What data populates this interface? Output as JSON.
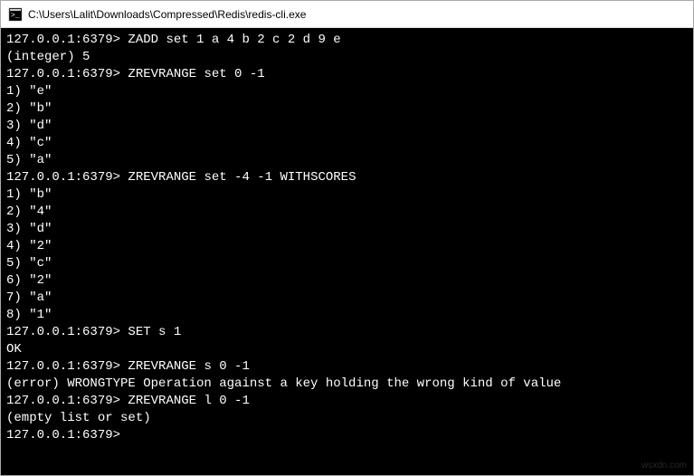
{
  "window": {
    "title": "C:\\Users\\Lalit\\Downloads\\Compressed\\Redis\\redis-cli.exe"
  },
  "terminal": {
    "lines": [
      {
        "prompt": "127.0.0.1:6379>",
        "text": " ZADD set 1 a 4 b 2 c 2 d 9 e"
      },
      {
        "prompt": "",
        "text": "(integer) 5"
      },
      {
        "prompt": "127.0.0.1:6379>",
        "text": " ZREVRANGE set 0 -1"
      },
      {
        "prompt": "",
        "text": "1) \"e\""
      },
      {
        "prompt": "",
        "text": "2) \"b\""
      },
      {
        "prompt": "",
        "text": "3) \"d\""
      },
      {
        "prompt": "",
        "text": "4) \"c\""
      },
      {
        "prompt": "",
        "text": "5) \"a\""
      },
      {
        "prompt": "127.0.0.1:6379>",
        "text": " ZREVRANGE set -4 -1 WITHSCORES"
      },
      {
        "prompt": "",
        "text": "1) \"b\""
      },
      {
        "prompt": "",
        "text": "2) \"4\""
      },
      {
        "prompt": "",
        "text": "3) \"d\""
      },
      {
        "prompt": "",
        "text": "4) \"2\""
      },
      {
        "prompt": "",
        "text": "5) \"c\""
      },
      {
        "prompt": "",
        "text": "6) \"2\""
      },
      {
        "prompt": "",
        "text": "7) \"a\""
      },
      {
        "prompt": "",
        "text": "8) \"1\""
      },
      {
        "prompt": "127.0.0.1:6379>",
        "text": " SET s 1"
      },
      {
        "prompt": "",
        "text": "OK"
      },
      {
        "prompt": "127.0.0.1:6379>",
        "text": " ZREVRANGE s 0 -1"
      },
      {
        "prompt": "",
        "text": "(error) WRONGTYPE Operation against a key holding the wrong kind of value"
      },
      {
        "prompt": "127.0.0.1:6379>",
        "text": " ZREVRANGE l 0 -1"
      },
      {
        "prompt": "",
        "text": "(empty list or set)"
      },
      {
        "prompt": "127.0.0.1:6379>",
        "text": ""
      }
    ]
  },
  "watermark": "wsxdn.com"
}
